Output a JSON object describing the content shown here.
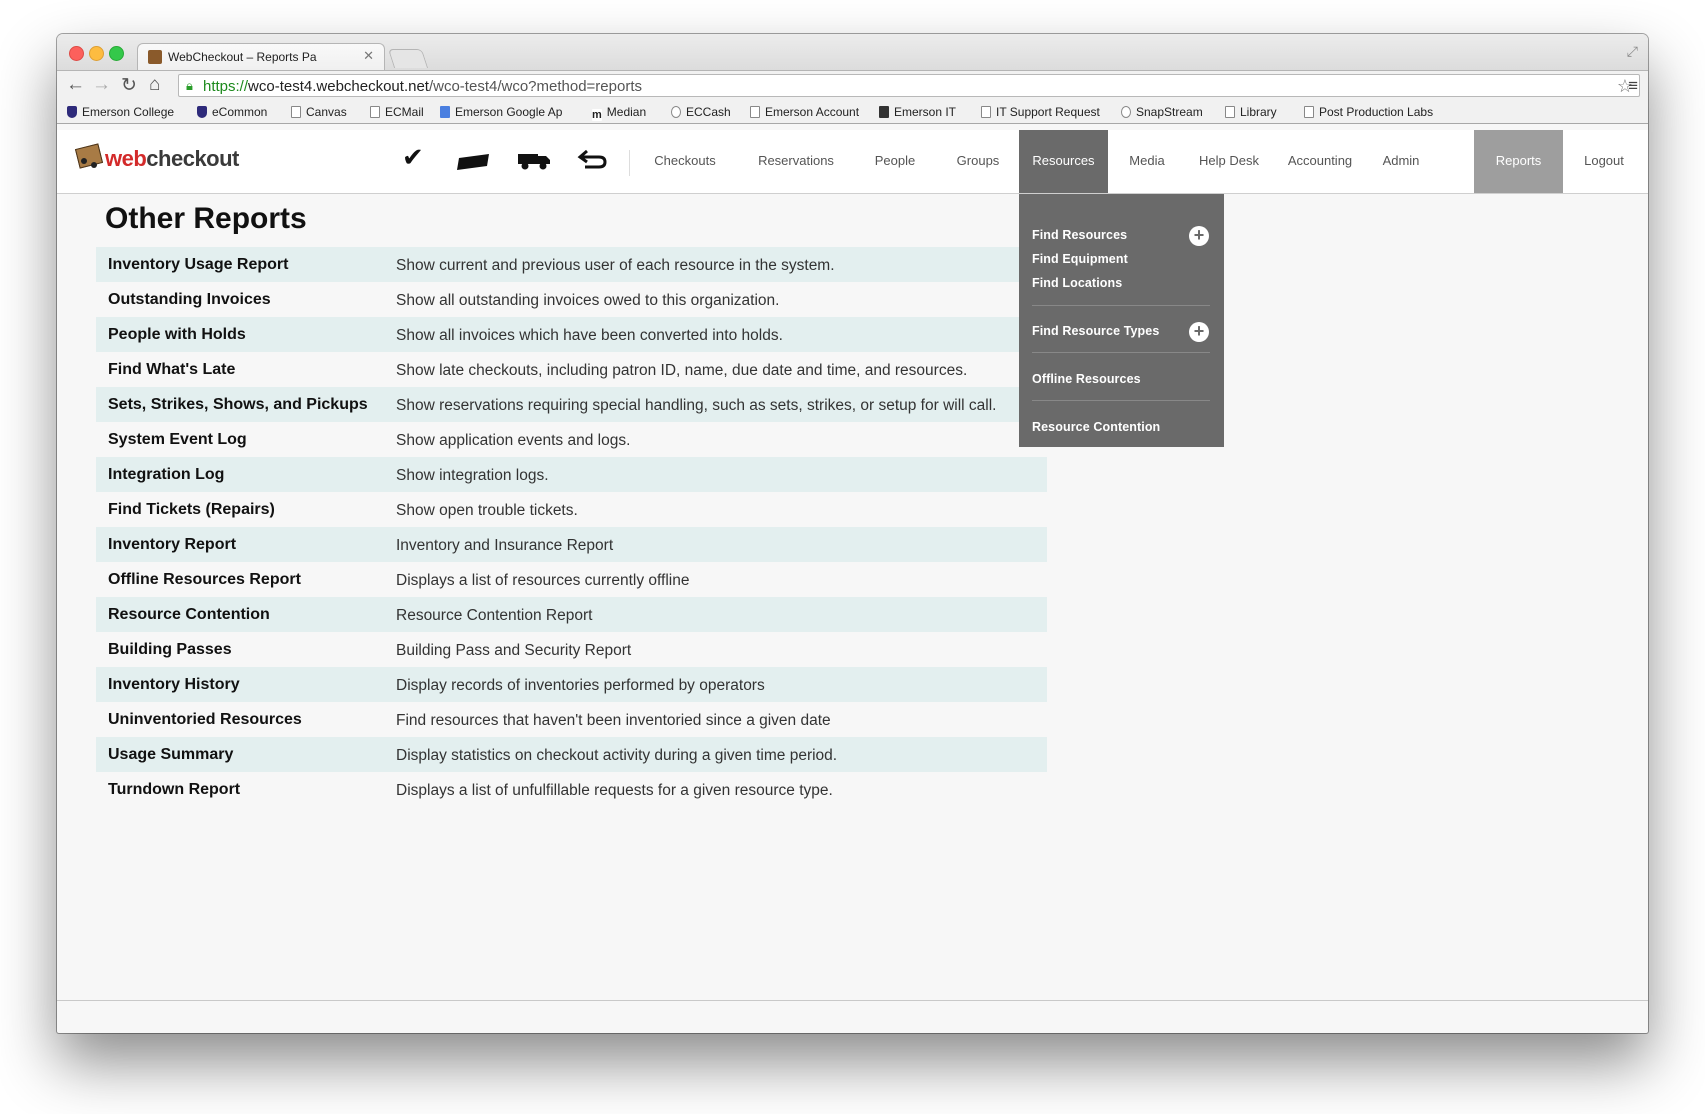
{
  "browser": {
    "tab_title": "WebCheckout – Reports Pa",
    "url_scheme": "https://",
    "url_host": "wco-test4.webcheckout.net",
    "url_path": "/wco-test4/wco?method=reports",
    "bookmarks": [
      {
        "label": "Emerson College",
        "icon": "shield"
      },
      {
        "label": "eCommon",
        "icon": "shield"
      },
      {
        "label": "Canvas",
        "icon": "page"
      },
      {
        "label": "ECMail",
        "icon": "page"
      },
      {
        "label": "Emerson Google Ap",
        "icon": "g"
      },
      {
        "label": "Median",
        "icon": "m"
      },
      {
        "label": "ECCash",
        "icon": "circle"
      },
      {
        "label": "Emerson Account",
        "icon": "page"
      },
      {
        "label": "Emerson IT",
        "icon": "screen"
      },
      {
        "label": "IT Support Request",
        "icon": "page"
      },
      {
        "label": "SnapStream",
        "icon": "circle"
      },
      {
        "label": "Library",
        "icon": "page"
      },
      {
        "label": "Post Production Labs",
        "icon": "page"
      }
    ]
  },
  "header": {
    "logo_web": "web",
    "logo_checkout": "checkout",
    "nav": [
      {
        "label": "Checkouts"
      },
      {
        "label": "Reservations"
      },
      {
        "label": "People"
      },
      {
        "label": "Groups"
      },
      {
        "label": "Resources",
        "state": "open"
      },
      {
        "label": "Media"
      },
      {
        "label": "Help Desk"
      },
      {
        "label": "Accounting"
      },
      {
        "label": "Admin"
      },
      {
        "label": "Reports",
        "state": "current"
      },
      {
        "label": "Logout"
      }
    ]
  },
  "dropdown": {
    "items": [
      "Find Resources",
      "Find Equipment",
      "Find Locations",
      "Find Resource Types",
      "Offline Resources",
      "Resource Contention"
    ]
  },
  "page": {
    "title": "Other Reports",
    "reports": [
      {
        "name": "Inventory Usage Report",
        "desc": "Show current and previous user of each resource in the system."
      },
      {
        "name": "Outstanding Invoices",
        "desc": "Show all outstanding invoices owed to this organization."
      },
      {
        "name": "People with Holds",
        "desc": "Show all invoices which have been converted into holds."
      },
      {
        "name": "Find What's Late",
        "desc": "Show late checkouts, including patron ID, name, due date and time, and resources."
      },
      {
        "name": "Sets, Strikes, Shows, and Pickups",
        "desc": "Show reservations requiring special handling, such as sets, strikes, or setup for will call."
      },
      {
        "name": "System Event Log",
        "desc": "Show application events and logs."
      },
      {
        "name": "Integration Log",
        "desc": "Show integration logs."
      },
      {
        "name": "Find Tickets (Repairs)",
        "desc": "Show open trouble tickets."
      },
      {
        "name": "Inventory Report",
        "desc": "Inventory and Insurance Report"
      },
      {
        "name": "Offline Resources Report",
        "desc": "Displays a list of resources currently offline"
      },
      {
        "name": "Resource Contention",
        "desc": "Resource Contention Report"
      },
      {
        "name": "Building Passes",
        "desc": "Building Pass and Security Report"
      },
      {
        "name": "Inventory History",
        "desc": "Display records of inventories performed by operators"
      },
      {
        "name": "Uninventoried Resources",
        "desc": "Find resources that haven't been inventoried since a given date"
      },
      {
        "name": "Usage Summary",
        "desc": "Display statistics on checkout activity during a given time period."
      },
      {
        "name": "Turndown Report",
        "desc": "Displays a list of unfulfillable requests for a given resource type."
      }
    ]
  }
}
